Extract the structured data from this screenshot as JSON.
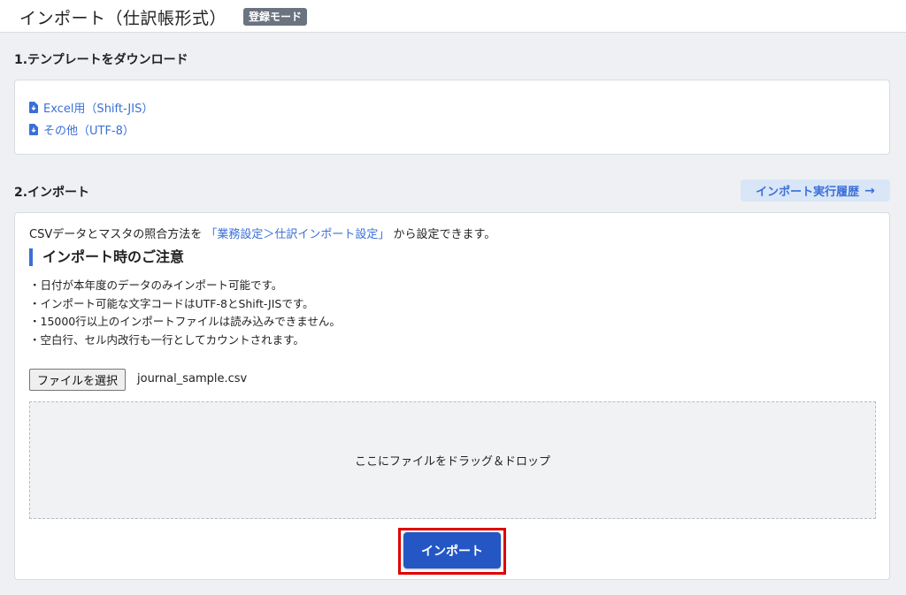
{
  "header": {
    "title": "インポート（仕訳帳形式）",
    "mode_badge": "登録モード"
  },
  "template_section": {
    "title": "1.テンプレートをダウンロード",
    "links": [
      {
        "label": "Excel用（Shift-JIS）",
        "icon": "file-download-icon"
      },
      {
        "label": "その他（UTF-8）",
        "icon": "file-download-icon"
      }
    ]
  },
  "import_section": {
    "title": "2.インポート",
    "history_button": "インポート実行履歴",
    "history_icon": "arrow-right-icon",
    "intro_prefix": "CSVデータとマスタの照合方法を",
    "intro_link": "「業務設定＞仕訳インポート設定」",
    "intro_suffix": "から設定できます。",
    "notice_heading": "インポート時のご注意",
    "notices": [
      "・日付が本年度のデータのみインポート可能です。",
      "・インポート可能な文字コードはUTF-8とShift-JISです。",
      "・15000行以上のインポートファイルは読み込みできません。",
      "・空白行、セル内改行も一行としてカウントされます。"
    ],
    "choose_file_button": "ファイルを選択",
    "selected_file": "journal_sample.csv",
    "drop_zone_text": "ここにファイルをドラッグ＆ドロップ",
    "import_button": "インポート"
  },
  "colors": {
    "accent": "#3a6fd8",
    "primary_button": "#2457c4",
    "highlight_border": "#e00000",
    "badge": "#6b7380"
  }
}
